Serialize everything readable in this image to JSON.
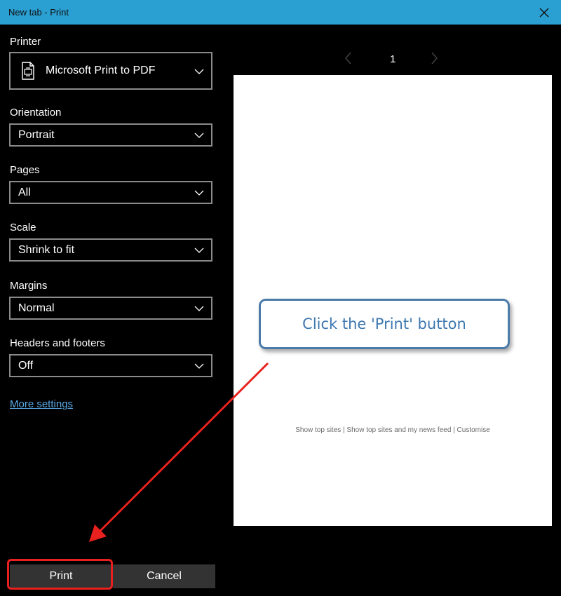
{
  "window": {
    "title": "New tab - Print"
  },
  "printer": {
    "label": "Printer",
    "value": "Microsoft Print to PDF"
  },
  "orientation": {
    "label": "Orientation",
    "value": "Portrait"
  },
  "pages": {
    "label": "Pages",
    "value": "All"
  },
  "scale": {
    "label": "Scale",
    "value": "Shrink to fit"
  },
  "margins": {
    "label": "Margins",
    "value": "Normal"
  },
  "headers_footers": {
    "label": "Headers and footers",
    "value": "Off"
  },
  "more_settings": "More settings",
  "buttons": {
    "print": "Print",
    "cancel": "Cancel"
  },
  "preview": {
    "page_number": "1",
    "footer_text": "Show top sites | Show top sites and my news feed | Customise"
  },
  "callout": {
    "text": "Click the 'Print' button"
  },
  "colors": {
    "titlebar": "#2a9fd1",
    "background": "#000000",
    "link": "#5aa9e6",
    "highlight": "#e8211e",
    "callout_border": "#4b7ba8"
  }
}
